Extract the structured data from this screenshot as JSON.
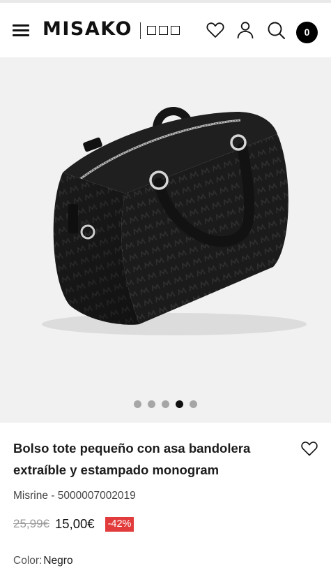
{
  "header": {
    "brand": "MISAKO",
    "cart_count": "0"
  },
  "gallery": {
    "image_alt": "Bolso tote pequeño negro con estampado monogram",
    "slide_count": 5,
    "active_slide": 4
  },
  "product": {
    "title": "Bolso tote pequeño con asa bandolera extraíble y estampado monogram",
    "reference": "Misrine - 5000007002019",
    "old_price": "25,99€",
    "price": "15,00€",
    "discount": "-42%",
    "color_label": "Color:",
    "color_value": "Negro"
  },
  "colors": {
    "discount_badge": "#e23b3b",
    "gallery_bg": "#f1f1f1",
    "cart_badge": "#000000"
  },
  "icons": [
    "menu-icon",
    "heart-icon",
    "user-icon",
    "search-icon",
    "heart-icon"
  ]
}
